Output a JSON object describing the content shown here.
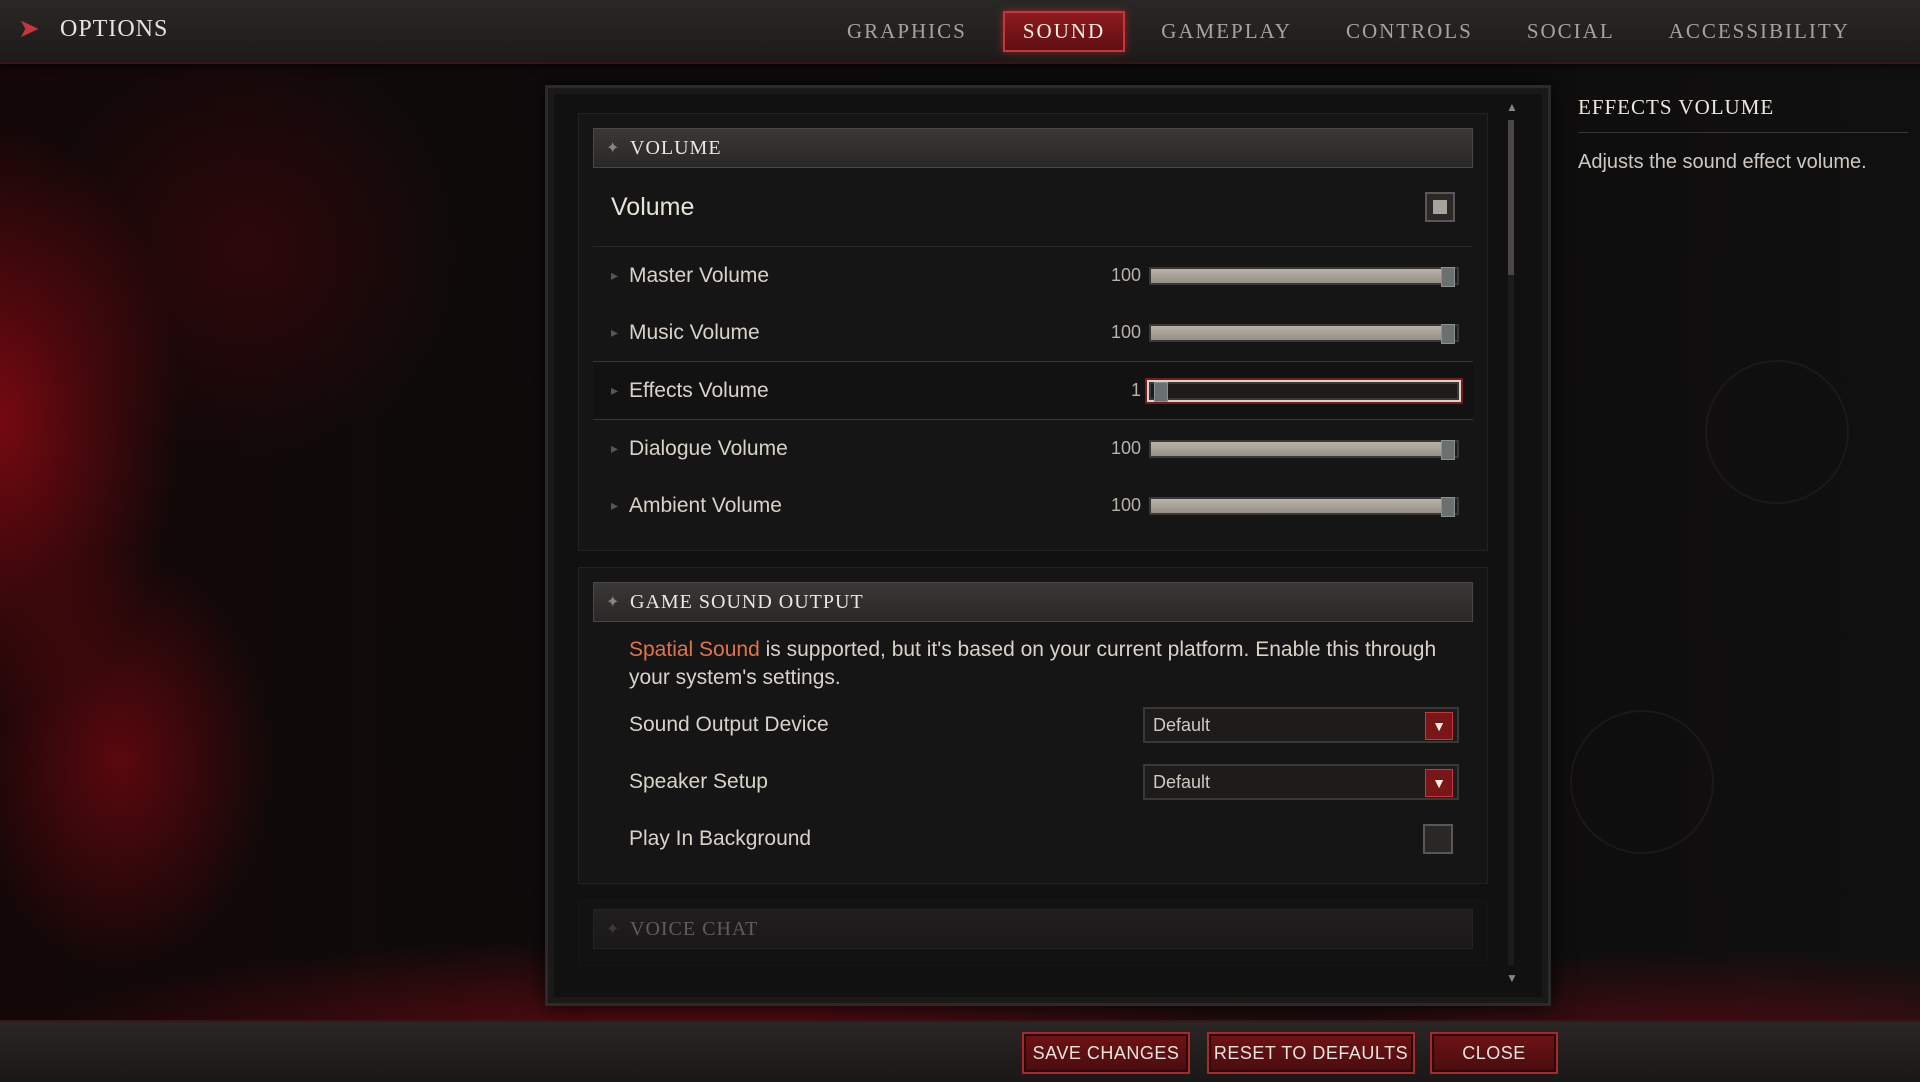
{
  "header": {
    "title": "OPTIONS",
    "tabs": [
      {
        "label": "GRAPHICS",
        "active": false
      },
      {
        "label": "SOUND",
        "active": true
      },
      {
        "label": "GAMEPLAY",
        "active": false
      },
      {
        "label": "CONTROLS",
        "active": false
      },
      {
        "label": "SOCIAL",
        "active": false
      },
      {
        "label": "ACCESSIBILITY",
        "active": false
      }
    ]
  },
  "volume_section": {
    "header": "VOLUME",
    "master_toggle_label": "Volume",
    "master_toggle_checked": true,
    "sliders": [
      {
        "label": "Master Volume",
        "value": "100",
        "fraction": 1.0
      },
      {
        "label": "Music Volume",
        "value": "100",
        "fraction": 1.0
      },
      {
        "label": "Effects Volume",
        "value": "1",
        "fraction": 0.01
      },
      {
        "label": "Dialogue Volume",
        "value": "100",
        "fraction": 1.0
      },
      {
        "label": "Ambient Volume",
        "value": "100",
        "fraction": 1.0
      }
    ]
  },
  "output_section": {
    "header": "GAME SOUND OUTPUT",
    "desc_accent": "Spatial Sound",
    "desc_rest": " is supported, but it's based on your current platform. Enable this through your system's settings.",
    "sound_output_device_label": "Sound Output Device",
    "sound_output_device_value": "Default",
    "speaker_setup_label": "Speaker Setup",
    "speaker_setup_value": "Default",
    "play_in_background_label": "Play In Background",
    "play_in_background_checked": false
  },
  "voice_section": {
    "header": "VOICE CHAT"
  },
  "info": {
    "title": "EFFECTS VOLUME",
    "text": "Adjusts the sound effect volume."
  },
  "footer": {
    "save": "SAVE CHANGES",
    "reset": "RESET TO DEFAULTS",
    "close": "CLOSE"
  },
  "colors": {
    "accent_red": "#c8353a",
    "highlight_text": "#e0744c"
  }
}
